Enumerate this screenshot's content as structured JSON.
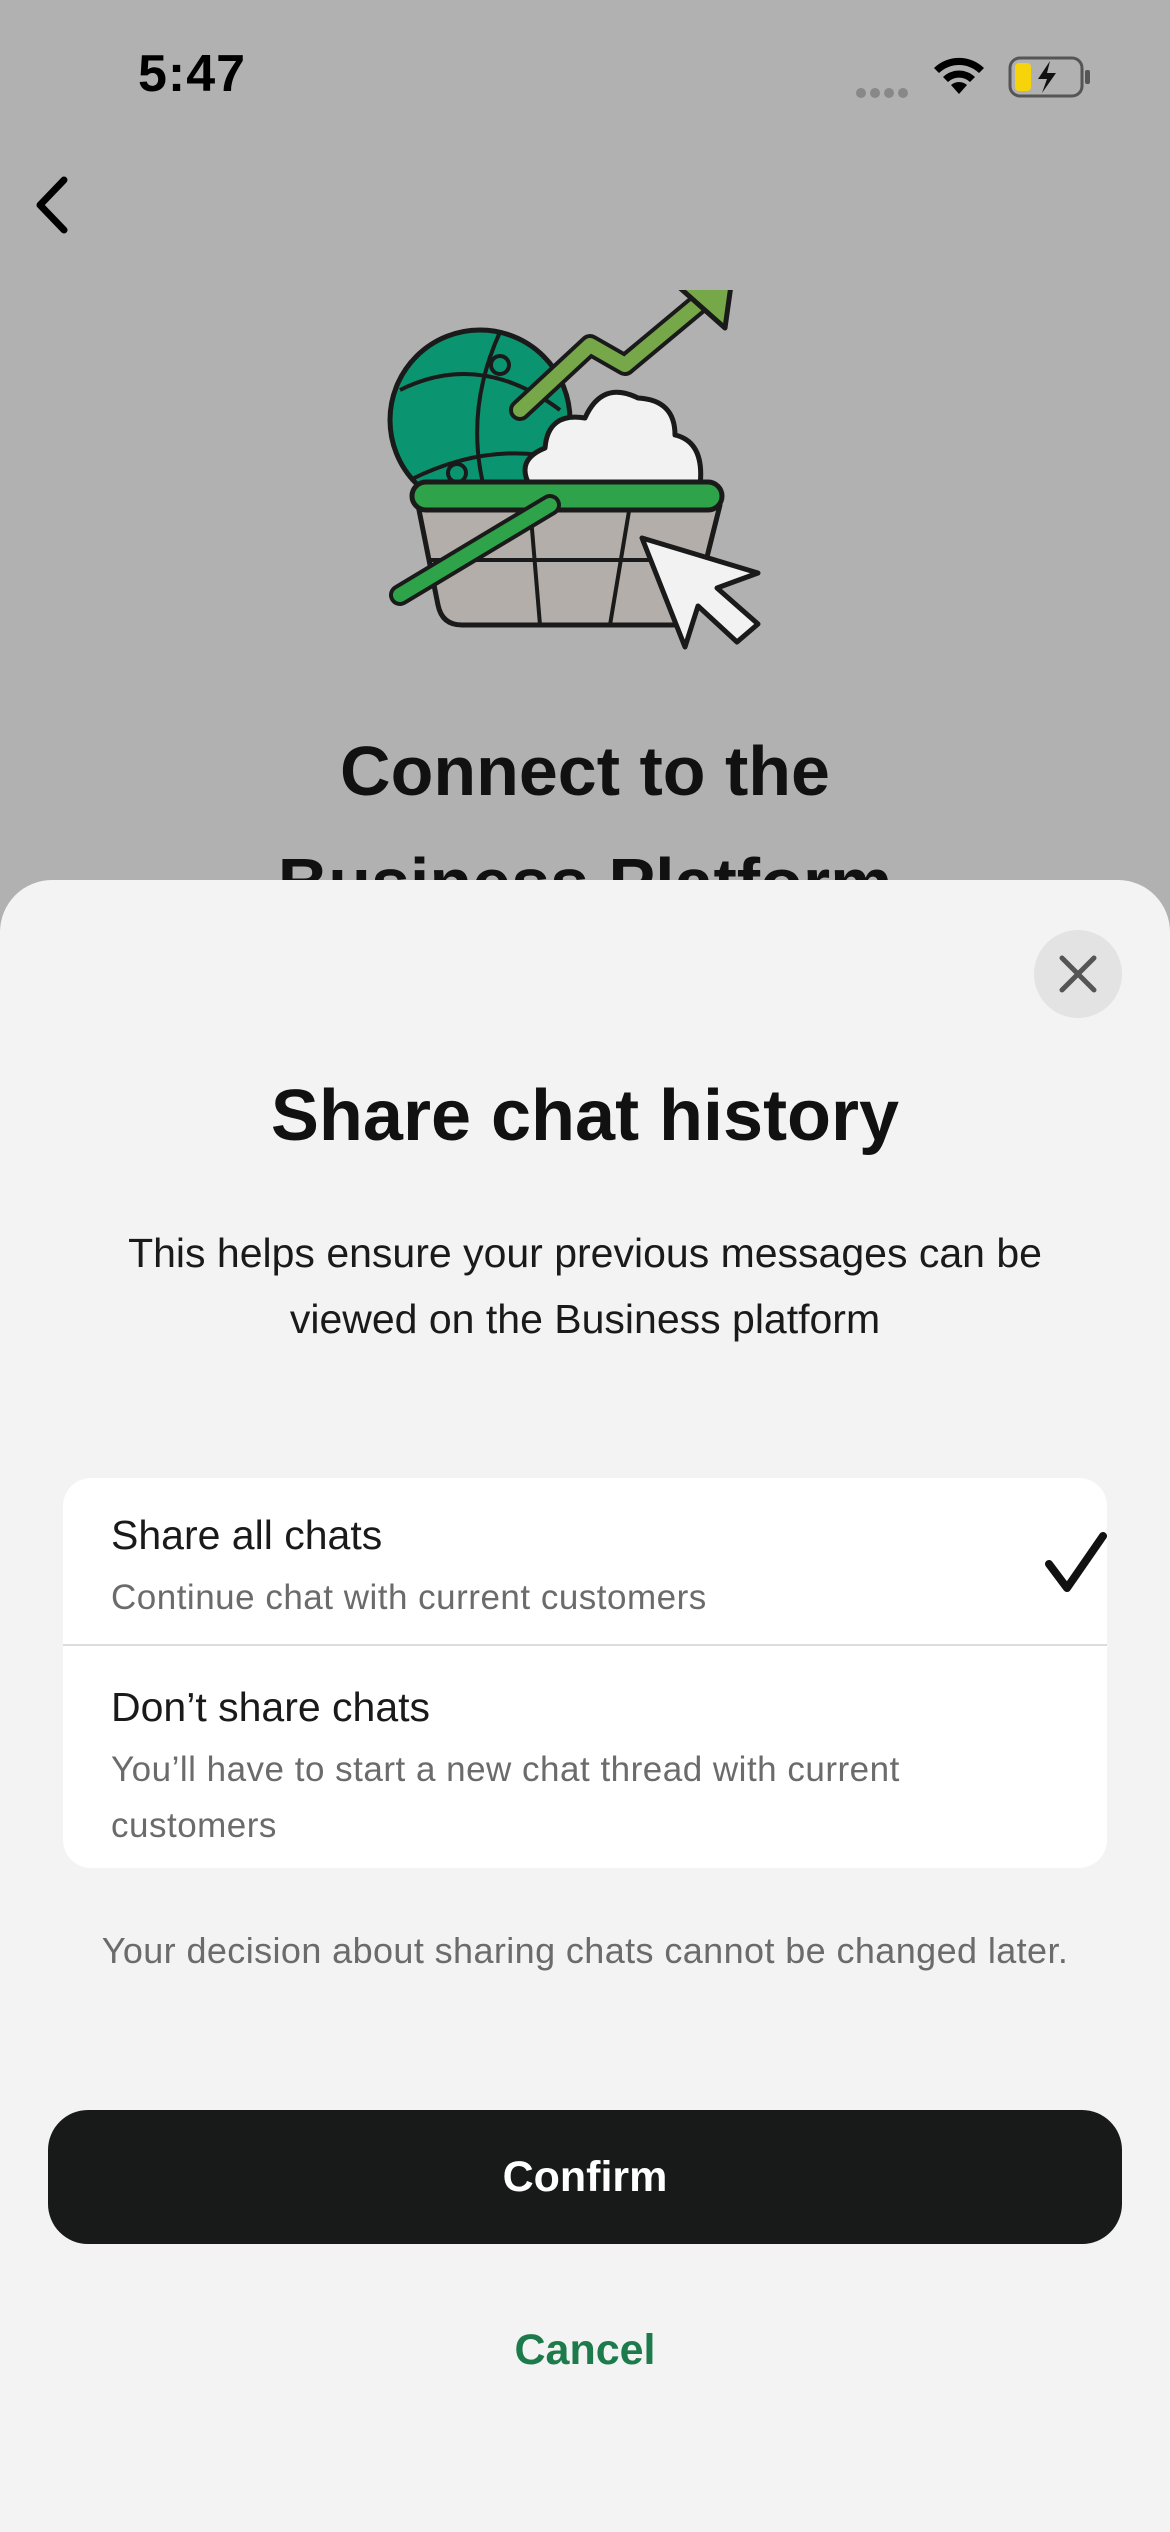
{
  "status_bar": {
    "time": "5:47"
  },
  "background_screen": {
    "title_line1": "Connect to the",
    "title_line2": "Business Platform",
    "illustration": "globe-cloud-basket-arrow-illustration"
  },
  "sheet": {
    "title": "Share chat history",
    "description": "This helps ensure your previous messages can be viewed on the Business platform",
    "options": [
      {
        "title": "Share all chats",
        "subtitle": "Continue chat with current customers",
        "selected": true
      },
      {
        "title": "Don’t share chats",
        "subtitle": "You’ll have to start a new chat thread with current customers",
        "selected": false
      }
    ],
    "note": "Your decision about sharing chats cannot be changed later.",
    "confirm_label": "Confirm",
    "cancel_label": "Cancel"
  },
  "icons": {
    "back": "chevron-left-icon",
    "close": "close-icon",
    "check": "checkmark-icon",
    "wifi": "wifi-icon",
    "battery": "battery-charging-icon"
  },
  "colors": {
    "primary_button": "#181a1a",
    "cancel_link": "#1d7a4b",
    "sheet_background": "#f3f3f3",
    "dim_overlay_background": "#b1b1b1",
    "globe_green": "#0a9470",
    "arrow_green": "#76a84a",
    "battery_yellow": "#f7d40a"
  }
}
